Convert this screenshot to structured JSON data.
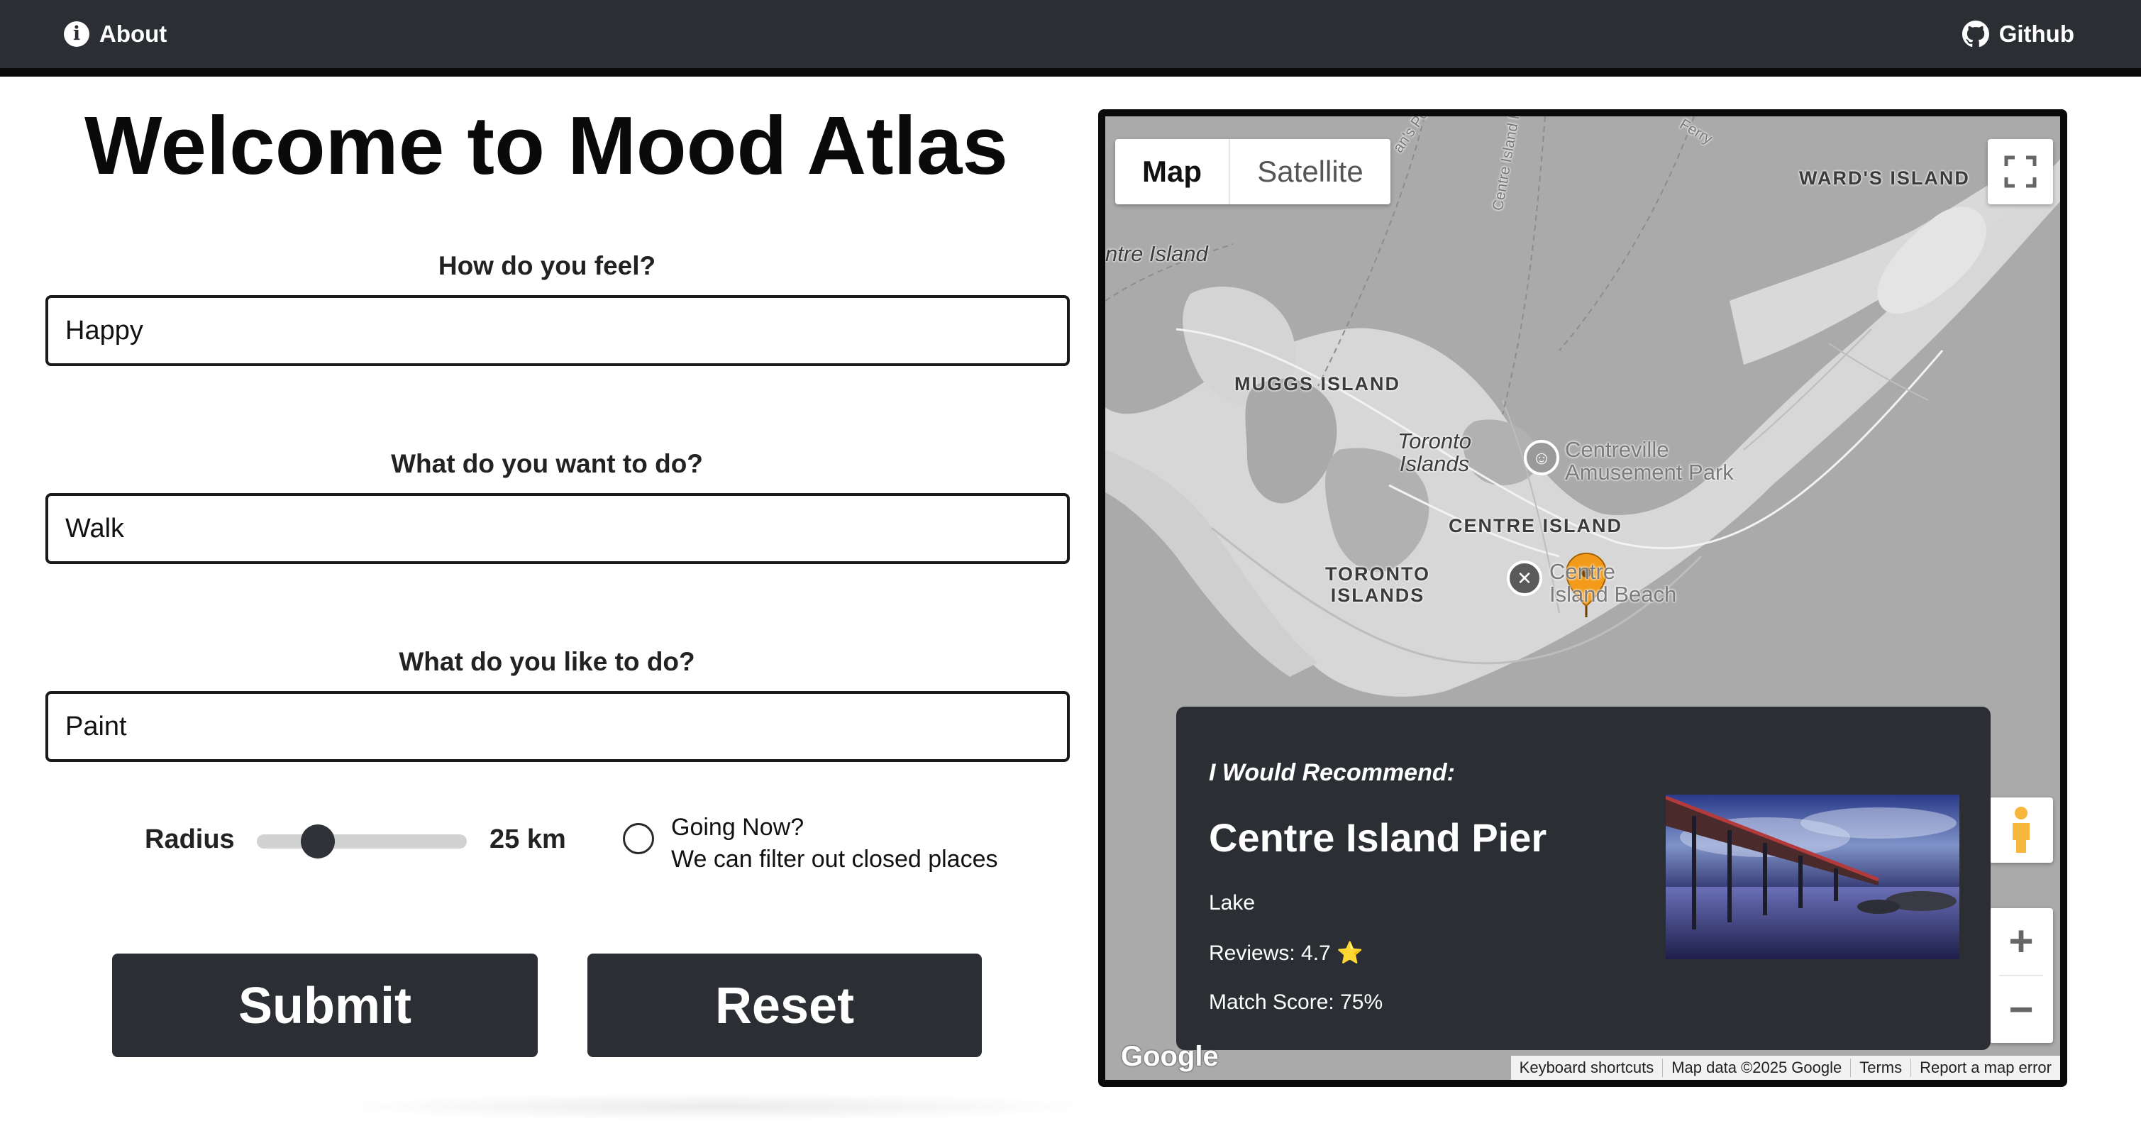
{
  "nav": {
    "about_label": "About",
    "github_label": "Github"
  },
  "main": {
    "title": "Welcome to Mood Atlas",
    "feel": {
      "label": "How do you feel?",
      "value": "Happy"
    },
    "want": {
      "label": "What do you want to do?",
      "value": "Walk"
    },
    "like": {
      "label": "What do you like to do?",
      "value": "Paint"
    },
    "radius": {
      "label": "Radius",
      "value_text": "25 km",
      "slider_fraction": 0.29
    },
    "going_now": {
      "label": "Going Now?",
      "sublabel": "We can filter out closed places",
      "checked": false
    },
    "submit_label": "Submit",
    "reset_label": "Reset"
  },
  "map": {
    "type_buttons": {
      "map": "Map",
      "satellite": "Satellite"
    },
    "labels": {
      "wards_island": "WARD'S ISLAND",
      "centre_island_partial": "ntre Island",
      "muggs_island": "MUGGS ISLAND",
      "toronto_islands_1": "Toronto",
      "toronto_islands_2": "Islands",
      "centreville_1": "Centreville",
      "centreville_2": "Amusement Park",
      "centre_island": "CENTRE ISLAND",
      "toronto_islands_caps_1": "TORONTO",
      "toronto_islands_caps_2": "ISLANDS",
      "beach_1": "Centre",
      "beach_2": "Island Beach",
      "ferry_road": "Centre Island Ferry",
      "ferry_partial": "Ferry",
      "point_partial": "an's Point F"
    },
    "recommendation": {
      "heading": "I Would Recommend:",
      "name": "Centre Island Pier",
      "category": "Lake",
      "reviews": "Reviews: 4.7 ⭐",
      "match": "Match Score: 75%"
    },
    "zoom": {
      "in": "+",
      "out": "−"
    },
    "attribution": [
      "Keyboard shortcuts",
      "Map data ©2025 Google",
      "Terms",
      "Report a map error"
    ],
    "logo": "Google",
    "colors": {
      "marker": "#f29b1a",
      "navbar": "#2b2e33"
    }
  }
}
